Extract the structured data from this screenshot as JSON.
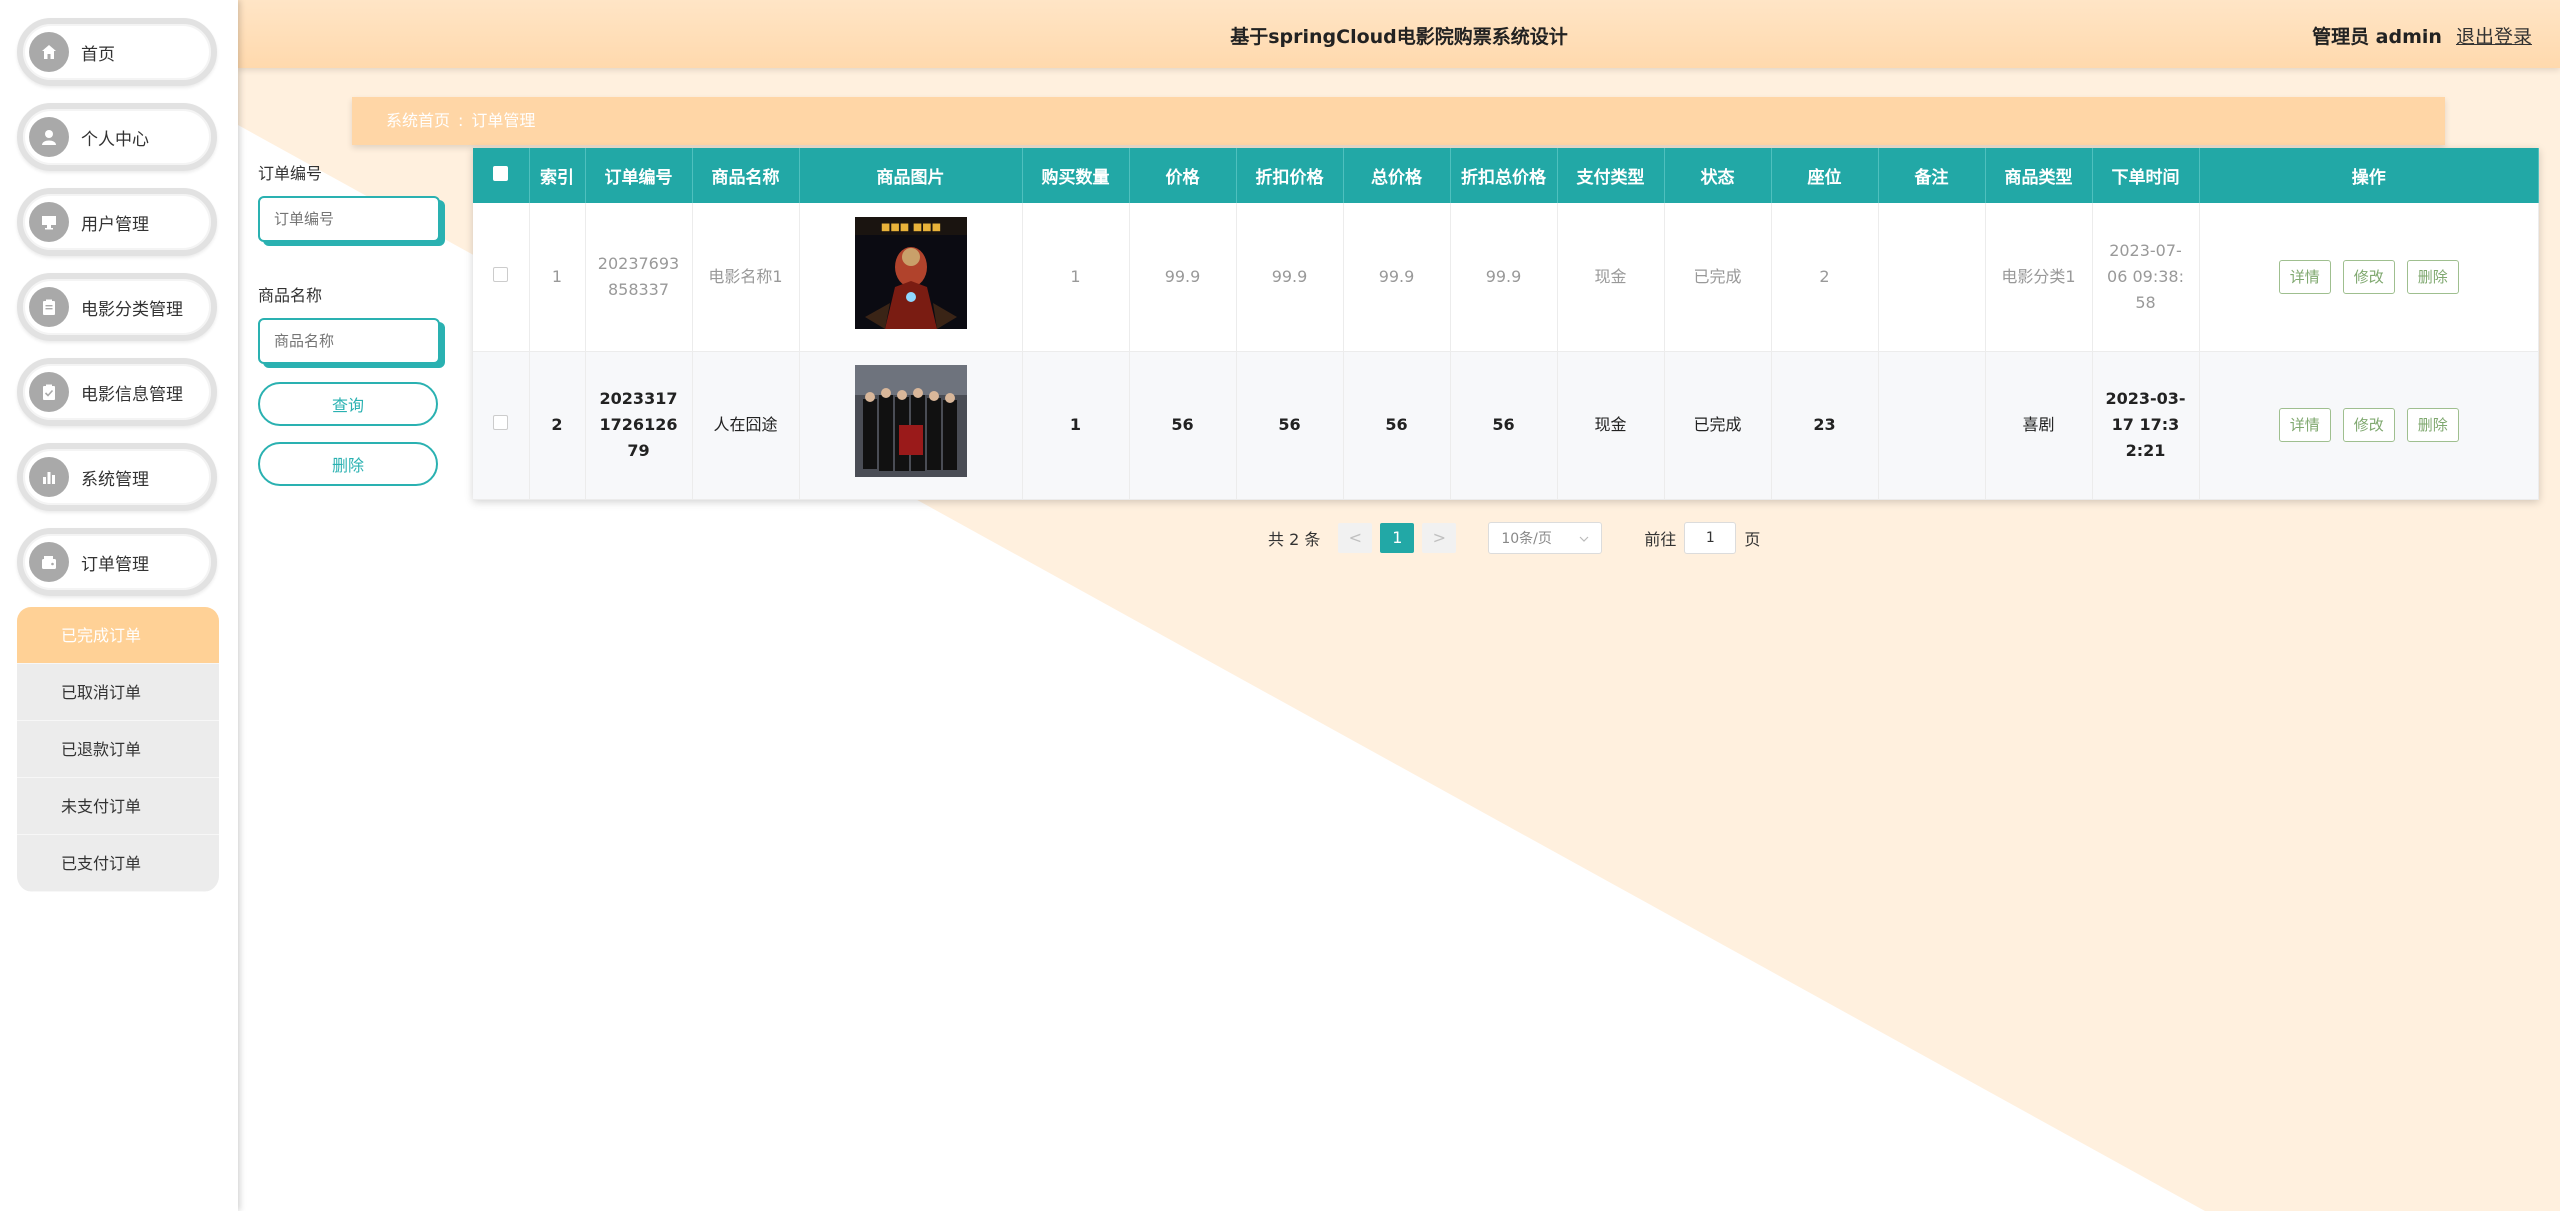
{
  "app": {
    "title": "基于springCloud电影院购票系统设计",
    "user_role": "管理员 admin",
    "logout_label": "退出登录"
  },
  "colors": {
    "accent": "#22a8a6",
    "header": "#ffdcb4",
    "active_sub": "#ffd196"
  },
  "sidebar": {
    "items": [
      {
        "label": "首页",
        "icon": "home-icon"
      },
      {
        "label": "个人中心",
        "icon": "person-icon"
      },
      {
        "label": "用户管理",
        "icon": "monitor-icon"
      },
      {
        "label": "电影分类管理",
        "icon": "clipboard-icon"
      },
      {
        "label": "电影信息管理",
        "icon": "checklist-icon"
      },
      {
        "label": "系统管理",
        "icon": "chart-icon"
      },
      {
        "label": "订单管理",
        "icon": "wallet-icon"
      }
    ],
    "order_submenu": [
      "已完成订单",
      "已取消订单",
      "已退款订单",
      "未支付订单",
      "已支付订单"
    ]
  },
  "breadcrumb": {
    "home": "系统首页",
    "separator": ":",
    "current": "订单管理"
  },
  "search": {
    "order_no_label": "订单编号",
    "order_no_placeholder": "订单编号",
    "product_name_label": "商品名称",
    "product_name_placeholder": "商品名称",
    "query_label": "查询",
    "delete_label": "删除"
  },
  "table": {
    "columns": [
      "索引",
      "订单编号",
      "商品名称",
      "商品图片",
      "购买数量",
      "价格",
      "折扣价格",
      "总价格",
      "折扣总价格",
      "支付类型",
      "状态",
      "座位",
      "备注",
      "商品类型",
      "下单时间",
      "操作"
    ],
    "rows": [
      {
        "index": "1",
        "order_no": "20237693858337",
        "product_name": "电影名称1",
        "quantity": "1",
        "price": "99.9",
        "discount_price": "99.9",
        "total_price": "99.9",
        "discount_total": "99.9",
        "pay_type": "现金",
        "status": "已完成",
        "seat": "2",
        "remark": "",
        "product_type": "电影分类1",
        "order_time": "2023-07-06 09:38:58"
      },
      {
        "index": "2",
        "order_no": "2023317172612679",
        "product_name": "人在囧途",
        "quantity": "1",
        "price": "56",
        "discount_price": "56",
        "total_price": "56",
        "discount_total": "56",
        "pay_type": "现金",
        "status": "已完成",
        "seat": "23",
        "remark": "",
        "product_type": "喜剧",
        "order_time": "2023-03-17 17:32:21"
      }
    ],
    "actions": {
      "detail": "详情",
      "edit": "修改",
      "delete": "删除"
    }
  },
  "pagination": {
    "total_text": "共 2 条",
    "prev": "<",
    "current_page": "1",
    "next": ">",
    "page_size": "10条/页",
    "goto_label": "前往",
    "goto_value": "1",
    "page_suffix": "页"
  }
}
